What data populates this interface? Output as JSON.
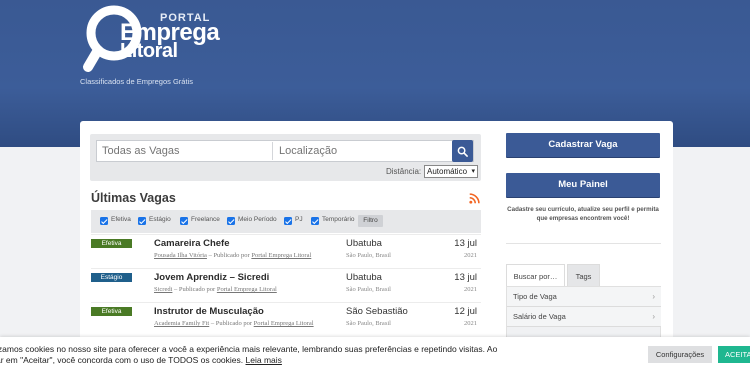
{
  "brand": {
    "portal": "PORTAL",
    "line1": "Emprega",
    "line2": "Litoral",
    "tagline": "Classificados de Empregos Grátis"
  },
  "search": {
    "query_placeholder": "Todas as Vagas",
    "location_placeholder": "Localização",
    "distance_label": "Distância:",
    "distance_value": "Automático"
  },
  "listing": {
    "title": "Últimas Vagas",
    "filters": [
      "Efetiva",
      "Estágio",
      "Freelance",
      "Meio Período",
      "PJ",
      "Temporário"
    ],
    "filter_button": "Filtro",
    "jobs": [
      {
        "type": "Efetiva",
        "type_color": "#4a7a25",
        "title": "Camareira Chefe",
        "company": "Pousada Ilha Vitória",
        "posted_by_prefix": " – Publicado por ",
        "posted_by": "Portal Emprega Litoral",
        "city": "Ubatuba",
        "state": "São Paulo, Brasil",
        "date": "13 jul",
        "year": "2021"
      },
      {
        "type": "Estágio",
        "type_color": "#1f5f8b",
        "title": "Jovem Aprendiz – Sicredi",
        "company": "Sicredi",
        "posted_by_prefix": " – Publicado por ",
        "posted_by": "Portal Emprega Litoral",
        "city": "Ubatuba",
        "state": "São Paulo, Brasil",
        "date": "13 jul",
        "year": "2021"
      },
      {
        "type": "Efetiva",
        "type_color": "#4a7a25",
        "title": "Instrutor de Musculação",
        "company": "Academia Family Fit",
        "posted_by_prefix": " – Publicado por ",
        "posted_by": "Portal Emprega Litoral",
        "city": "São Sebastião",
        "state": "São Paulo, Brasil",
        "date": "12 jul",
        "year": "2021"
      }
    ]
  },
  "sidebar": {
    "register_button": "Cadastrar Vaga",
    "panel_button": "Meu Painel",
    "note": "Cadastre seu currículo, atualize seu perfil e permita que empresas encontrem você!",
    "tabs": [
      "Buscar por…",
      "Tags"
    ],
    "items": [
      "Tipo de Vaga",
      "Salário de Vaga"
    ]
  },
  "cookie": {
    "text": "izamos cookies no nosso site para oferecer a você a experiência mais relevante, lembrando suas preferências e repetindo visitas. Ao",
    "text2": "ar em \"Aceitar\", você concorda com o uso de TODOS os cookies.",
    "link": "Leia mais",
    "settings_button": "Configurações",
    "accept_button": "ACEITA"
  },
  "colors": {
    "header_blue": "#3a5993",
    "button_blue": "#3b5a96",
    "accept_green": "#1fb790",
    "rss_orange": "#f26522"
  }
}
